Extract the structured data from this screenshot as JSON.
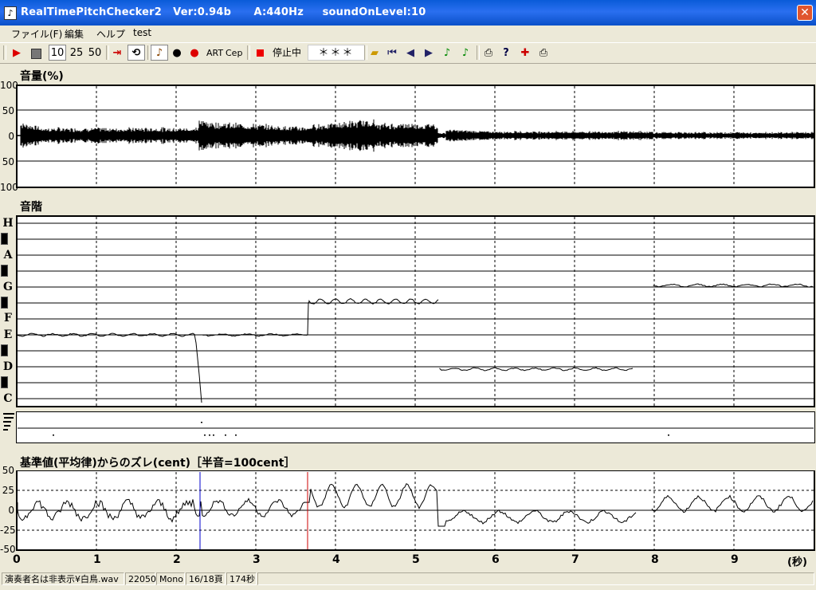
{
  "window": {
    "title": "RealTimePitchChecker2   Ver:0.94b      A:440Hz     soundOnLevel:10",
    "icon": "music-note-icon"
  },
  "menu": [
    "ファイル(F)",
    "編集",
    "ヘルプ",
    "test"
  ],
  "toolbar": {
    "rec_icon": "play-icon",
    "stop_icon": "stop-icon",
    "speed_10": "10",
    "speed_25": "25",
    "speed_50": "50",
    "art_label": "ART",
    "cep_label": "Cep",
    "status": "停止中",
    "note_display": "＊＊＊"
  },
  "volume": {
    "title": "音量(%)",
    "ticks": [
      "100",
      "50",
      "0",
      "50",
      "100"
    ]
  },
  "scale": {
    "title": "音階",
    "notes": [
      "H",
      "A",
      "G",
      "F",
      "E",
      "D",
      "C"
    ]
  },
  "deviation": {
    "title": "基準値(平均律)からのズレ(cent)［半音=100cent］",
    "ticks": [
      "50",
      "25",
      "0",
      "-25",
      "-50"
    ]
  },
  "time_axis": {
    "ticks": [
      "0",
      "1",
      "2",
      "3",
      "4",
      "5",
      "6",
      "7",
      "8",
      "9"
    ],
    "unit": "(秒)"
  },
  "status": {
    "file": "演奏者名は非表示¥白鳥.wav",
    "rate": "22050",
    "channels": "Mono",
    "page": "16/18頁",
    "duration": "174秒"
  },
  "colors": {
    "titlebar": "#0a5bd8",
    "close": "#e0552e",
    "marker_blue": "#0000cc",
    "marker_red": "#cc0000"
  }
}
